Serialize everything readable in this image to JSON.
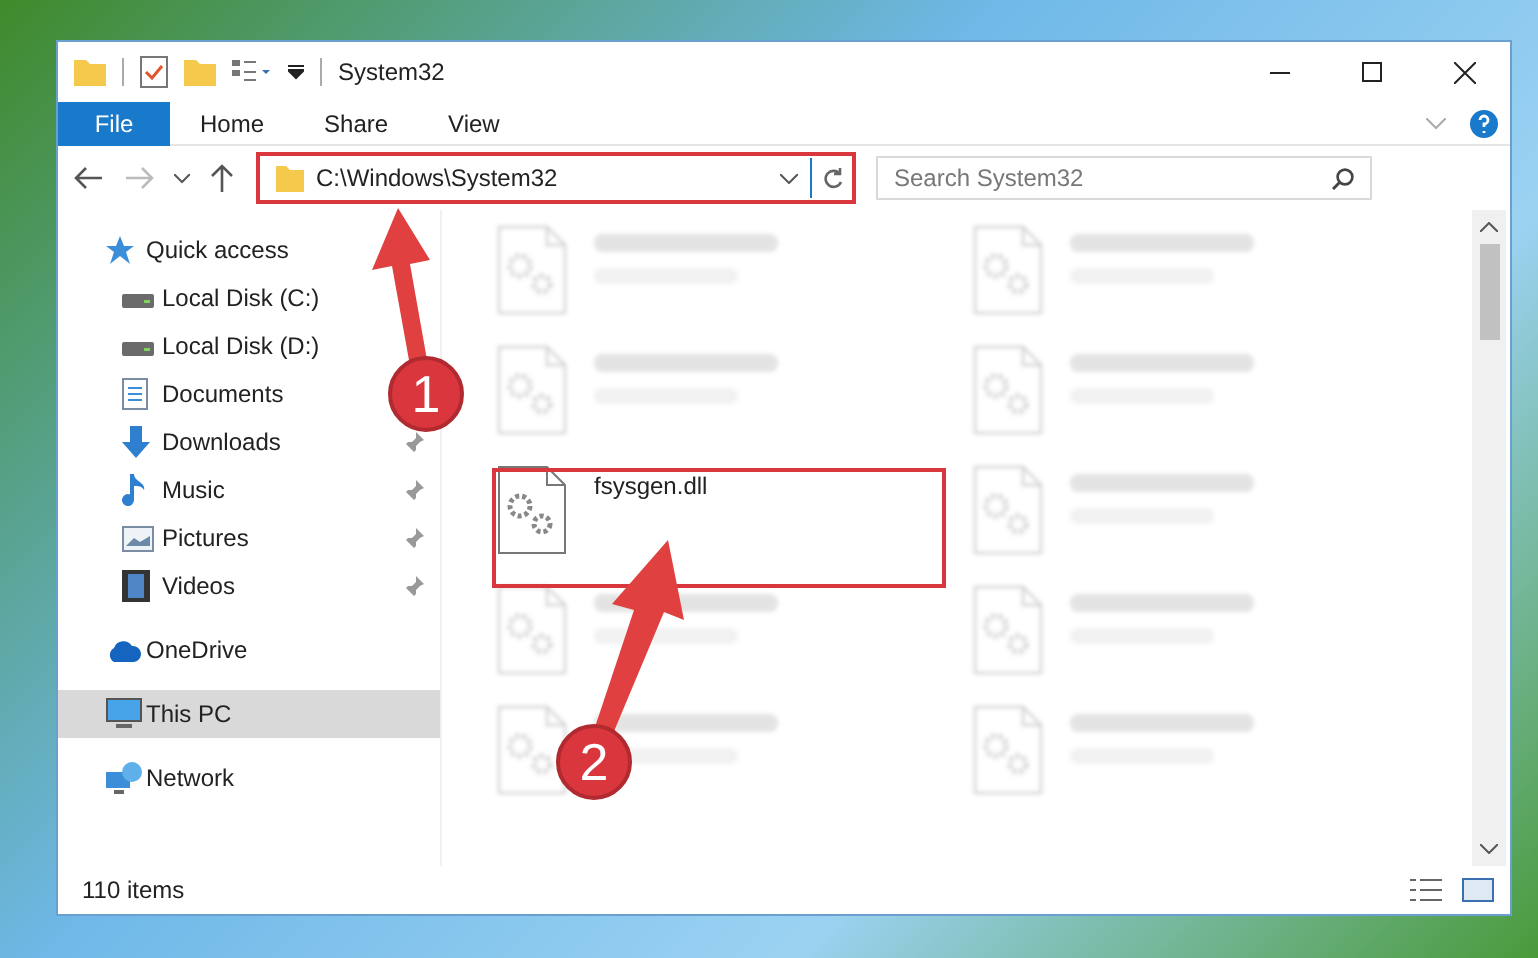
{
  "window": {
    "title": "System32"
  },
  "ribbon_tabs": [
    {
      "label": "File",
      "kind": "file"
    },
    {
      "label": "Home",
      "kind": "tab"
    },
    {
      "label": "Share",
      "kind": "tab"
    },
    {
      "label": "View",
      "kind": "tab"
    }
  ],
  "address_bar": {
    "path": "C:\\Windows\\System32"
  },
  "search": {
    "placeholder": "Search System32"
  },
  "sidebar": {
    "items": [
      {
        "label": "Quick access",
        "kind": "star",
        "selected": false,
        "children": [
          {
            "label": "Local Disk (C:)",
            "kind": "drive",
            "pinned": false,
            "selected": false
          },
          {
            "label": "Local Disk (D:)",
            "kind": "drive",
            "pinned": false,
            "selected": false
          },
          {
            "label": "Documents",
            "kind": "documents",
            "pinned": false,
            "selected": false
          },
          {
            "label": "Downloads",
            "kind": "downloads",
            "pinned": true,
            "selected": false
          },
          {
            "label": "Music",
            "kind": "music",
            "pinned": true,
            "selected": false
          },
          {
            "label": "Pictures",
            "kind": "pictures",
            "pinned": true,
            "selected": false
          },
          {
            "label": "Videos",
            "kind": "videos",
            "pinned": true,
            "selected": false
          }
        ]
      },
      {
        "label": "OneDrive",
        "kind": "cloud",
        "selected": false
      },
      {
        "label": "This PC",
        "kind": "computer",
        "selected": true
      },
      {
        "label": "Network",
        "kind": "network",
        "selected": false
      }
    ]
  },
  "files": [
    {
      "blurred": true
    },
    {
      "blurred": true
    },
    {
      "blurred": true
    },
    {
      "blurred": true
    },
    {
      "name": "fsysgen.dll",
      "blurred": false
    },
    {
      "blurred": true
    },
    {
      "blurred": true
    },
    {
      "blurred": true
    },
    {
      "blurred": true
    },
    {
      "blurred": true
    }
  ],
  "status_bar": {
    "count": "110 items"
  },
  "annotations": [
    {
      "label": "1"
    },
    {
      "label": "2"
    }
  ]
}
